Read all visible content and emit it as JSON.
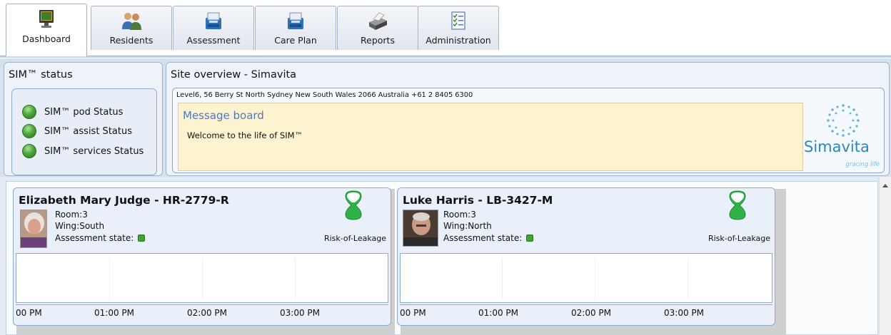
{
  "tabs": [
    {
      "label": "Dashboard",
      "icon": "monitor-icon",
      "active": true
    },
    {
      "label": "Residents",
      "icon": "people-icon",
      "active": false
    },
    {
      "label": "Assessment",
      "icon": "assessment-icon",
      "active": false
    },
    {
      "label": "Care Plan",
      "icon": "care-plan-icon",
      "active": false
    },
    {
      "label": "Reports",
      "icon": "printer-icon",
      "active": false
    },
    {
      "label": "Administration",
      "icon": "checklist-icon",
      "active": false
    }
  ],
  "sim_status": {
    "title": "SIM™ status",
    "items": [
      {
        "label": "SIM™ pod  Status",
        "state": "ok",
        "color": "#4ca83a"
      },
      {
        "label": "SIM™ assist Status",
        "state": "ok",
        "color": "#4ca83a"
      },
      {
        "label": "SIM™ services Status",
        "state": "ok",
        "color": "#4ca83a"
      }
    ]
  },
  "site": {
    "title": "Site overview - Simavita",
    "address": "Level6, 56 Berry St  North Sydney New South Wales 2066 Australia +61 2 8405 6300",
    "message_board": {
      "title": "Message board",
      "text": "Welcome to the life of SIM™"
    },
    "logo": {
      "name": "Simavita",
      "tagline": "gracing life"
    }
  },
  "residents": [
    {
      "name": "Elizabeth Mary Judge  -  HR-2779-R",
      "room": "Room:3",
      "wing": "Wing:South",
      "assessment_label": "Assessment state:",
      "assessment_color": "#3ea52f",
      "risk_label": "Risk-of-Leakage",
      "timeline": [
        "00 PM",
        "01:00 PM",
        "02:00 PM",
        "03:00 PM"
      ]
    },
    {
      "name": "Luke Harris  -  LB-3427-M",
      "room": "Room:3",
      "wing": "Wing:North",
      "assessment_label": "Assessment state:",
      "assessment_color": "#3ea52f",
      "risk_label": "Risk-of-Leakage",
      "timeline": [
        "00 PM",
        "01:00 PM",
        "02:00 PM",
        "03:00 PM"
      ]
    }
  ],
  "colors": {
    "accent": "#4f79c1",
    "status_green": "#4ca83a",
    "message_bg": "#fdf3cf",
    "panel_border": "#8eaad0"
  }
}
